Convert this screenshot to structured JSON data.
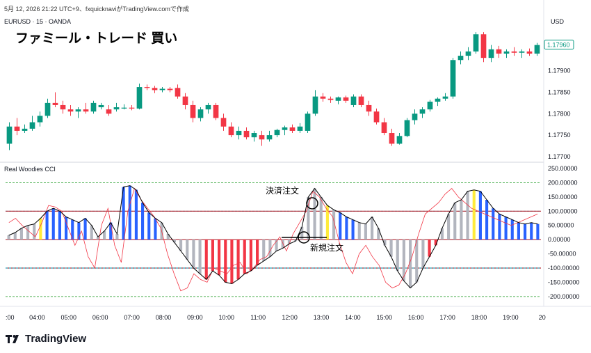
{
  "header": {
    "timestamp": "5月 12, 2026 21:22 UTC+9、fxquicknaviがTradingView.comで作成",
    "symbol": "EURUSD · 15 · OANDA",
    "title": "ファミール・トレード 買い",
    "currency": "USD"
  },
  "brand": {
    "name": "TradingView",
    "logo_icon": "tradingview-logo-icon"
  },
  "colors": {
    "up": "#089981",
    "down": "#f23645",
    "cci_blue": "#2962ff",
    "cci_red": "#f23645",
    "cci_gray": "#b2b5be",
    "cci_yellow": "#ffeb3b",
    "turbo": "#f23645",
    "level_red": "#b22833",
    "level_cyan": "#00bcd4",
    "level_green": "#4caf50",
    "price_tag": "#089981"
  },
  "chart_data": [
    {
      "type": "candlestick",
      "name": "EURUSD · 15 · OANDA",
      "ylabel": "USD",
      "yticks": [
        1.177,
        1.1775,
        1.178,
        1.1785,
        1.179
      ],
      "ytick_labels": [
        "1.17700",
        "1.17750",
        "1.17800",
        "1.17850",
        "1.17900"
      ],
      "last_price": 1.1796,
      "last_price_label": "1.17960",
      "x_start": "03:55",
      "interval_minutes": 15,
      "ohlc": [
        [
          1.1773,
          1.1778,
          1.17715,
          1.1777
        ],
        [
          1.1777,
          1.1779,
          1.1775,
          1.1776
        ],
        [
          1.1776,
          1.17775,
          1.17755,
          1.17765
        ],
        [
          1.17765,
          1.17795,
          1.1776,
          1.1778
        ],
        [
          1.1778,
          1.17805,
          1.1777,
          1.17795
        ],
        [
          1.17795,
          1.17835,
          1.1779,
          1.17825
        ],
        [
          1.17825,
          1.1785,
          1.17815,
          1.1782
        ],
        [
          1.1782,
          1.1783,
          1.178,
          1.1781
        ],
        [
          1.1781,
          1.1782,
          1.17795,
          1.17805
        ],
        [
          1.17805,
          1.17815,
          1.1779,
          1.1781
        ],
        [
          1.1781,
          1.17825,
          1.178,
          1.17805
        ],
        [
          1.17805,
          1.1783,
          1.178,
          1.17825
        ],
        [
          1.17815,
          1.17825,
          1.1781,
          1.1782
        ],
        [
          1.1781,
          1.1782,
          1.17795,
          1.178
        ],
        [
          1.1781,
          1.17825,
          1.17805,
          1.17815
        ],
        [
          1.17812,
          1.17822,
          1.1781,
          1.17814
        ],
        [
          1.17814,
          1.1782,
          1.17808,
          1.17812
        ],
        [
          1.17812,
          1.1787,
          1.1781,
          1.17862
        ],
        [
          1.17862,
          1.17868,
          1.17855,
          1.1786
        ],
        [
          1.1786,
          1.17865,
          1.17848,
          1.17855
        ],
        [
          1.17855,
          1.17862,
          1.1785,
          1.17858
        ],
        [
          1.17858,
          1.17862,
          1.1785,
          1.17855
        ],
        [
          1.1786,
          1.17868,
          1.17835,
          1.1784
        ],
        [
          1.1784,
          1.17848,
          1.1781,
          1.1782
        ],
        [
          1.1782,
          1.1783,
          1.1778,
          1.1779
        ],
        [
          1.1779,
          1.17815,
          1.17782,
          1.1781
        ],
        [
          1.1781,
          1.17825,
          1.178,
          1.1782
        ],
        [
          1.1782,
          1.17825,
          1.17785,
          1.1779
        ],
        [
          1.1779,
          1.178,
          1.1776,
          1.1777
        ],
        [
          1.1777,
          1.1778,
          1.17745,
          1.1775
        ],
        [
          1.1775,
          1.1777,
          1.1774,
          1.1776
        ],
        [
          1.1776,
          1.17768,
          1.1774,
          1.17745
        ],
        [
          1.17745,
          1.1776,
          1.17735,
          1.17755
        ],
        [
          1.1775,
          1.1776,
          1.17725,
          1.1774
        ],
        [
          1.1774,
          1.1776,
          1.17735,
          1.1775
        ],
        [
          1.1775,
          1.17765,
          1.17745,
          1.17762
        ],
        [
          1.17762,
          1.17772,
          1.1775,
          1.17768
        ],
        [
          1.17768,
          1.17775,
          1.17755,
          1.1776
        ],
        [
          1.1776,
          1.17778,
          1.17755,
          1.1777
        ],
        [
          1.1776,
          1.17805,
          1.17755,
          1.178
        ],
        [
          1.178,
          1.17855,
          1.17795,
          1.1784
        ],
        [
          1.1784,
          1.17848,
          1.17828,
          1.17835
        ],
        [
          1.17835,
          1.1784,
          1.17825,
          1.17832
        ],
        [
          1.1783,
          1.1784,
          1.17822,
          1.17838
        ],
        [
          1.17838,
          1.17842,
          1.17825,
          1.1783
        ],
        [
          1.1782,
          1.17845,
          1.17815,
          1.1784
        ],
        [
          1.1784,
          1.17845,
          1.17815,
          1.1782
        ],
        [
          1.1782,
          1.1783,
          1.17795,
          1.17805
        ],
        [
          1.17805,
          1.17812,
          1.17775,
          1.1778
        ],
        [
          1.1778,
          1.1779,
          1.1775,
          1.17755
        ],
        [
          1.17755,
          1.17765,
          1.17725,
          1.1773
        ],
        [
          1.1773,
          1.17755,
          1.17728,
          1.17748
        ],
        [
          1.17748,
          1.1779,
          1.17745,
          1.17785
        ],
        [
          1.17785,
          1.1781,
          1.17775,
          1.178
        ],
        [
          1.178,
          1.17815,
          1.1779,
          1.1781
        ],
        [
          1.1781,
          1.17832,
          1.17805,
          1.17828
        ],
        [
          1.17828,
          1.17838,
          1.17818,
          1.17835
        ],
        [
          1.17835,
          1.17848,
          1.1783,
          1.1784
        ],
        [
          1.1784,
          1.1793,
          1.17835,
          1.17925
        ],
        [
          1.17925,
          1.17945,
          1.17915,
          1.17935
        ],
        [
          1.17935,
          1.17955,
          1.17925,
          1.17945
        ],
        [
          1.17945,
          1.1799,
          1.1794,
          1.17985
        ],
        [
          1.17985,
          1.1799,
          1.1792,
          1.1793
        ],
        [
          1.1793,
          1.1796,
          1.1792,
          1.1795
        ],
        [
          1.1795,
          1.17958,
          1.1793,
          1.1794
        ],
        [
          1.1794,
          1.1795,
          1.1793,
          1.17945
        ],
        [
          1.17945,
          1.17955,
          1.17935,
          1.17942
        ],
        [
          1.17942,
          1.1795,
          1.1793,
          1.17945
        ],
        [
          1.17945,
          1.17952,
          1.17935,
          1.1794
        ],
        [
          1.1794,
          1.17965,
          1.17935,
          1.1796
        ]
      ]
    },
    {
      "type": "histogram+line",
      "name": "Real Woodies CCI",
      "yticks": [
        -200,
        -150,
        -100,
        -50,
        0,
        50,
        100,
        150,
        200,
        250
      ],
      "ytick_labels": [
        "-200.00000",
        "-150.00000",
        "-100.00000",
        "-50.00000",
        "0.00000",
        "50.00000",
        "100.00000",
        "150.00000",
        "200.00000",
        "250.00000"
      ],
      "ylim": [
        -215,
        255
      ],
      "levels": [
        {
          "value": 200,
          "color": "green"
        },
        {
          "value": 100,
          "color": "cyan"
        },
        {
          "value": 100,
          "color": "red"
        },
        {
          "value": 0,
          "color": "red"
        },
        {
          "value": -100,
          "color": "red"
        },
        {
          "value": -100,
          "color": "cyan"
        },
        {
          "value": -200,
          "color": "green"
        }
      ],
      "cci": [
        15,
        25,
        40,
        50,
        55,
        75,
        100,
        110,
        100,
        80,
        70,
        60,
        75,
        50,
        10,
        30,
        60,
        20,
        185,
        190,
        175,
        130,
        95,
        75,
        60,
        20,
        -10,
        -40,
        -70,
        -100,
        -120,
        -140,
        -110,
        -125,
        -150,
        -155,
        -140,
        -120,
        -110,
        -90,
        -75,
        -60,
        -40,
        -30,
        -15,
        -5,
        45,
        150,
        180,
        150,
        120,
        105,
        95,
        80,
        70,
        60,
        55,
        80,
        40,
        -20,
        -60,
        -110,
        -145,
        -170,
        -150,
        -100,
        -60,
        -20,
        40,
        90,
        130,
        140,
        170,
        175,
        170,
        140,
        110,
        90,
        80,
        70,
        60,
        55,
        60,
        55
      ],
      "cci_colors": [
        "gray",
        "gray",
        "gray",
        "gray",
        "gray",
        "yellow",
        "blue",
        "blue",
        "blue",
        "blue",
        "blue",
        "blue",
        "blue",
        "gray",
        "gray",
        "gray",
        "blue",
        "gray",
        "blue",
        "blue",
        "blue",
        "blue",
        "blue",
        "blue",
        "gray",
        "gray",
        "gray",
        "gray",
        "gray",
        "gray",
        "gray",
        "red",
        "red",
        "red",
        "red",
        "red",
        "red",
        "red",
        "red",
        "red",
        "gray",
        "gray",
        "gray",
        "gray",
        "gray",
        "gray",
        "gray",
        "gray",
        "gray",
        "gray",
        "yellow",
        "gray",
        "blue",
        "blue",
        "blue",
        "gray",
        "gray",
        "gray",
        "gray",
        "gray",
        "gray",
        "gray",
        "gray",
        "gray",
        "gray",
        "gray",
        "red",
        "red",
        "gray",
        "gray",
        "gray",
        "gray",
        "gray",
        "yellow",
        "blue",
        "blue",
        "blue",
        "blue",
        "blue",
        "blue",
        "blue",
        "blue",
        "blue",
        "blue"
      ],
      "turbo": [
        60,
        75,
        50,
        30,
        10,
        60,
        120,
        115,
        100,
        40,
        -20,
        30,
        -60,
        -100,
        50,
        110,
        -20,
        -80,
        100,
        180,
        140,
        110,
        80,
        40,
        -50,
        -120,
        -180,
        -170,
        -120,
        -140,
        -150,
        -100,
        -110,
        -120,
        -90,
        -80,
        -120,
        -100,
        -70,
        -60,
        -20,
        10,
        -40,
        20,
        60,
        100,
        170,
        150,
        110,
        80,
        -10,
        -80,
        -120,
        -50,
        -20,
        -60,
        -90,
        -150,
        -170,
        -160,
        -120,
        -60,
        20,
        90,
        110,
        130,
        160,
        180,
        150,
        130,
        110,
        100,
        90,
        80,
        70,
        60,
        50,
        60,
        70,
        80,
        90
      ],
      "annotations": [
        {
          "text": "決済注文",
          "type": "exit"
        },
        {
          "text": "新規注文",
          "type": "entry"
        }
      ]
    }
  ],
  "time_axis": {
    "labels": [
      ":00",
      "04:00",
      "05:00",
      "06:00",
      "07:00",
      "08:00",
      "09:00",
      "10:00",
      "11:00",
      "12:00",
      "13:00",
      "14:00",
      "15:00",
      "16:00",
      "17:00",
      "18:00",
      "19:00",
      "20"
    ]
  }
}
